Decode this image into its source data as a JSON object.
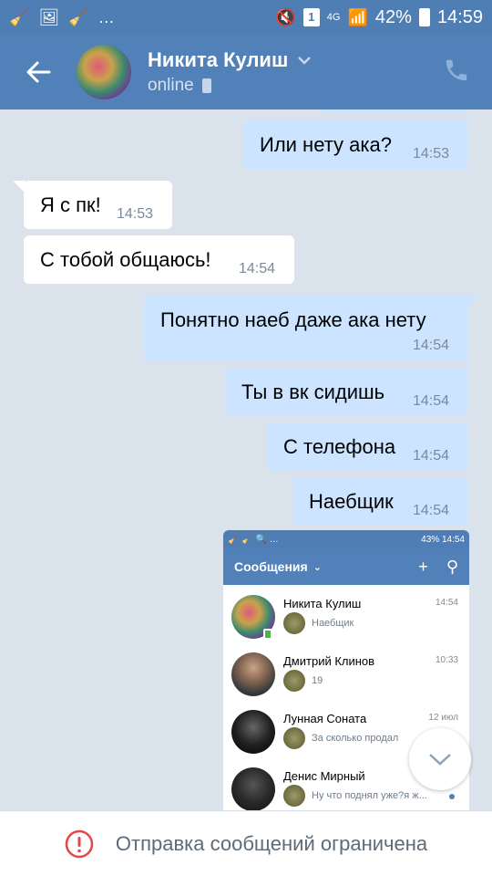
{
  "status_bar": {
    "battery": "42%",
    "time": "14:59",
    "network": "4G",
    "sim": "1"
  },
  "header": {
    "name": "Никита Кулиш",
    "status": "online"
  },
  "messages": [
    {
      "dir": "out",
      "text": "Или нету ака?",
      "time": "14:53"
    },
    {
      "dir": "in",
      "text": "Я с пк!",
      "time": "14:53"
    },
    {
      "dir": "in",
      "text": "С тобой общаюсь!",
      "time": "14:54"
    },
    {
      "dir": "out",
      "text": "Понятно наеб даже ака нету",
      "time": "14:54"
    },
    {
      "dir": "out",
      "text": "Ты в вк сидишь",
      "time": "14:54"
    },
    {
      "dir": "out",
      "text": "С телефона",
      "time": "14:54"
    },
    {
      "dir": "out",
      "text": "Наебщик",
      "time": "14:54"
    }
  ],
  "attachment": {
    "status_bar": {
      "battery": "43%",
      "time": "14:54"
    },
    "title": "Сообщения",
    "conversations": [
      {
        "name": "Никита Кулиш",
        "time": "14:54",
        "preview": "Наебщик"
      },
      {
        "name": "Дмитрий Клинов",
        "time": "10:33",
        "preview": "19"
      },
      {
        "name": "Лунная Соната",
        "time": "12 июл",
        "preview": "За сколько продал"
      },
      {
        "name": "Денис Мирный",
        "time": "",
        "preview": "Ну что поднял уже?я ж..."
      }
    ]
  },
  "bottom_bar": {
    "text": "Отправка сообщений ограничена"
  },
  "colors": {
    "header": "#5181b8",
    "outgoing": "#cce4ff",
    "incoming": "#ffffff",
    "background": "#dae2ec",
    "warning": "#e64646"
  }
}
